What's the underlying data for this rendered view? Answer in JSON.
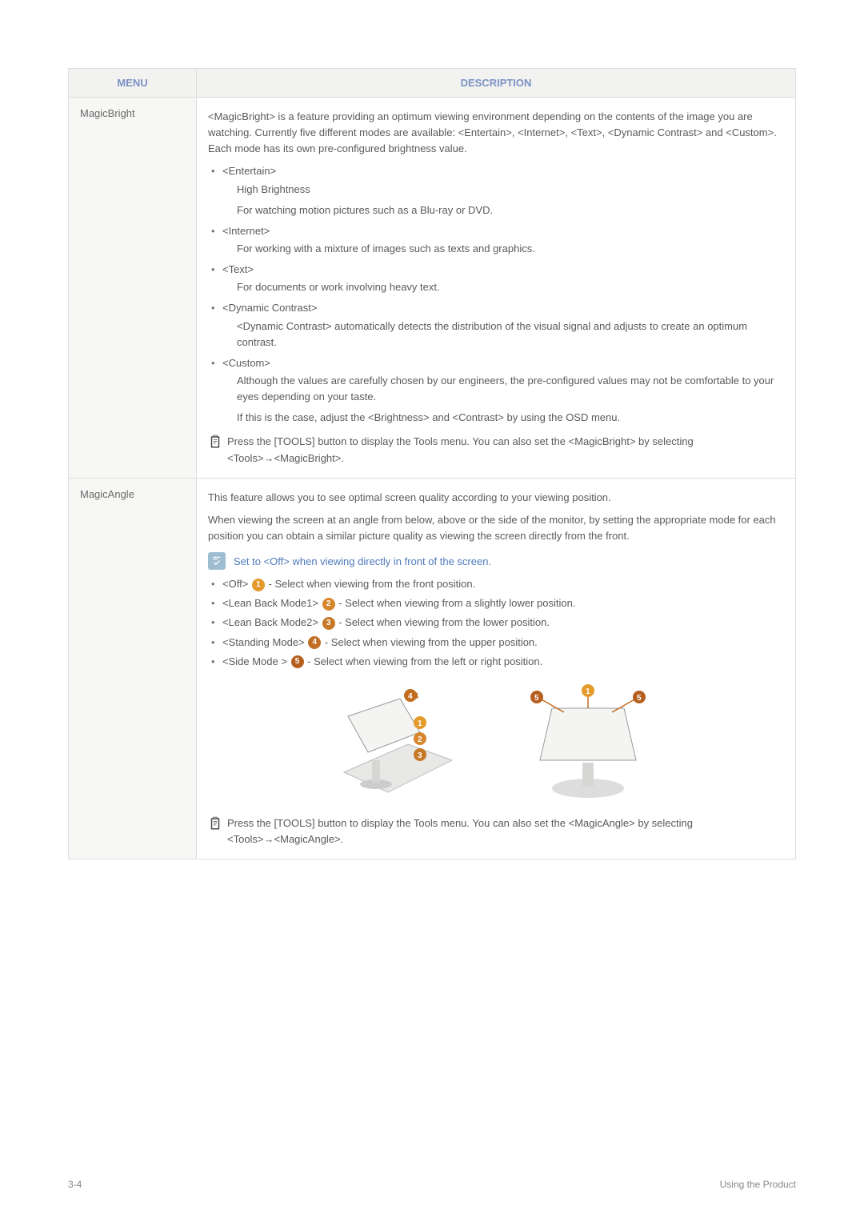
{
  "header": {
    "menu": "MENU",
    "description": "DESCRIPTION"
  },
  "rows": {
    "magicbright": {
      "title": "MagicBright",
      "intro": "<MagicBright> is a feature providing an optimum viewing environment depending on the contents of the image you are watching. Currently five different modes are available: <Entertain>, <Internet>, <Text>, <Dynamic Contrast> and <Custom>. Each mode has its own pre-configured brightness value.",
      "items": [
        {
          "label": "<Entertain>",
          "line1": "High Brightness",
          "line2": "For watching motion pictures such as a Blu-ray or DVD."
        },
        {
          "label": "<Internet>",
          "line1": "For working with a mixture of images such as texts and graphics."
        },
        {
          "label": "<Text>",
          "line1": "For documents or work involving heavy text."
        },
        {
          "label": "<Dynamic Contrast>",
          "line1": "<Dynamic Contrast> automatically detects the distribution of the visual signal and adjusts to create an optimum contrast."
        },
        {
          "label": "<Custom>",
          "line1": "Although the values are carefully chosen by our engineers, the pre-configured values may not be comfortable to your eyes depending on your taste.",
          "line2": "If this is the case, adjust the <Brightness> and <Contrast> by using the OSD menu."
        }
      ],
      "note": "Press the [TOOLS] button to display the Tools menu. You can also set the <MagicBright> by selecting <Tools>→<MagicBright>."
    },
    "magicangle": {
      "title": "MagicAngle",
      "p1": "This feature allows you to see optimal screen quality according to your viewing position.",
      "p2": "When viewing the screen at an angle from below, above or the side of the monitor, by setting the appropriate mode for each position you can obtain a similar picture quality as viewing the screen directly from the front.",
      "tip": "Set to <Off> when viewing directly in front of the screen.",
      "opts": [
        {
          "pre": "<Off> ",
          "num": "1",
          "post": " - Select when viewing from the front position."
        },
        {
          "pre": "<Lean Back Mode1> ",
          "num": "2",
          "post": " - Select when viewing from a slightly lower position."
        },
        {
          "pre": "<Lean Back Mode2> ",
          "num": "3",
          "post": " - Select when viewing from the lower position."
        },
        {
          "pre": "<Standing Mode> ",
          "num": "4",
          "post": " - Select when viewing from the upper position."
        },
        {
          "pre": "<Side Mode > ",
          "num": "5",
          "post": " - Select when viewing from the left or right position."
        }
      ],
      "note": "Press the [TOOLS] button to display the Tools menu. You can also set the <MagicAngle> by selecting <Tools>→<MagicAngle>."
    }
  },
  "footer": {
    "left": "3-4",
    "right": "Using the Product"
  }
}
